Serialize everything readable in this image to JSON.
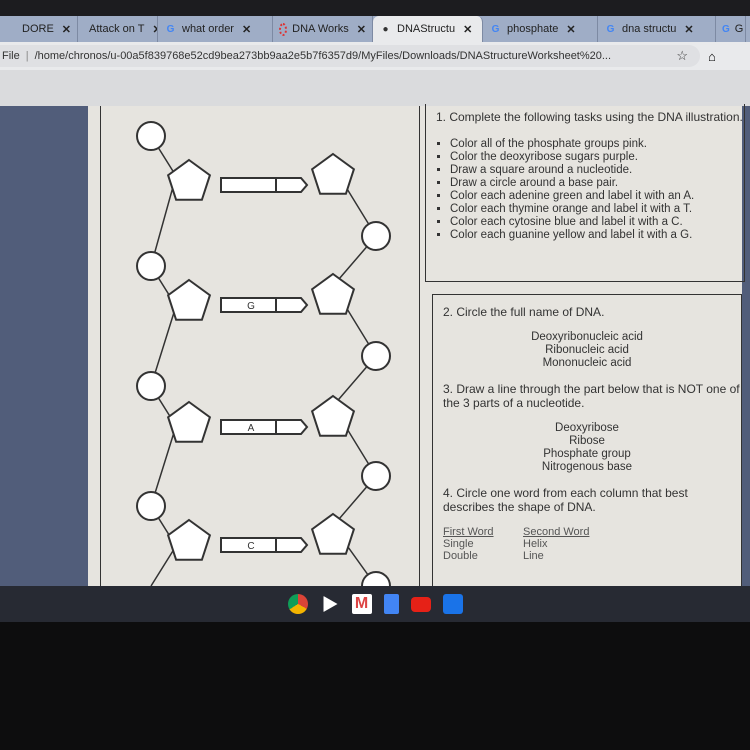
{
  "browser": {
    "tabs": [
      {
        "label": "DORE",
        "icon": "speaker-icon",
        "active": false
      },
      {
        "label": "Attack on T",
        "icon": "site-icon",
        "active": false
      },
      {
        "label": "what order",
        "icon": "google-icon",
        "active": false
      },
      {
        "label": "DNA Works",
        "icon": "loading-icon",
        "active": false
      },
      {
        "label": "DNAStructu",
        "icon": "globe-icon",
        "active": true
      },
      {
        "label": "phosphate",
        "icon": "google-icon",
        "active": false
      },
      {
        "label": "dna structu",
        "icon": "google-icon",
        "active": false
      },
      {
        "label": "G",
        "icon": "google-icon",
        "active": false
      }
    ],
    "address": {
      "scheme": "File",
      "url": "/home/chronos/u-00a5f839768e52cd9bea273bb9aa2e5b7f6357d9/MyFiles/Downloads/DNAStructureWorksheet%20..."
    }
  },
  "worksheet": {
    "diagram_labels": [
      "G",
      "A",
      "C"
    ],
    "q1": {
      "title": "1. Complete the following tasks using the DNA illustration.",
      "tasks": [
        "Color all of the phosphate groups pink.",
        "Color the deoxyribose sugars purple.",
        "Draw a square around a nucleotide.",
        "Draw a circle around a base pair.",
        "Color each adenine green and label it with an A.",
        "Color each thymine orange and label it with a T.",
        "Color each cytosine blue and label it with a C.",
        "Color each guanine yellow and label it with a G."
      ]
    },
    "q2": {
      "title": "2. Circle the full name of DNA.",
      "options": [
        "Deoxyribonucleic acid",
        "Ribonucleic acid",
        "Mononucleic acid"
      ]
    },
    "q3": {
      "title": "3. Draw a line through the part below that is NOT one of the 3 parts of a nucleotide.",
      "options": [
        "Deoxyribose",
        "Ribose",
        "Phosphate group",
        "Nitrogenous base"
      ]
    },
    "q4": {
      "title": "4. Circle one word from each column that best describes the shape of DNA.",
      "col1": {
        "header": "First Word",
        "items": [
          "Single",
          "Double"
        ]
      },
      "col2": {
        "header": "Second Word",
        "items": [
          "Helix",
          "Line"
        ]
      }
    }
  },
  "shelf": {
    "apps": [
      "chrome",
      "play-store",
      "gmail",
      "docs",
      "youtube",
      "files"
    ]
  },
  "colors": {
    "tabstrip": "#9fadc6",
    "shelf": "#272a33",
    "page_side": "#515d7a"
  }
}
